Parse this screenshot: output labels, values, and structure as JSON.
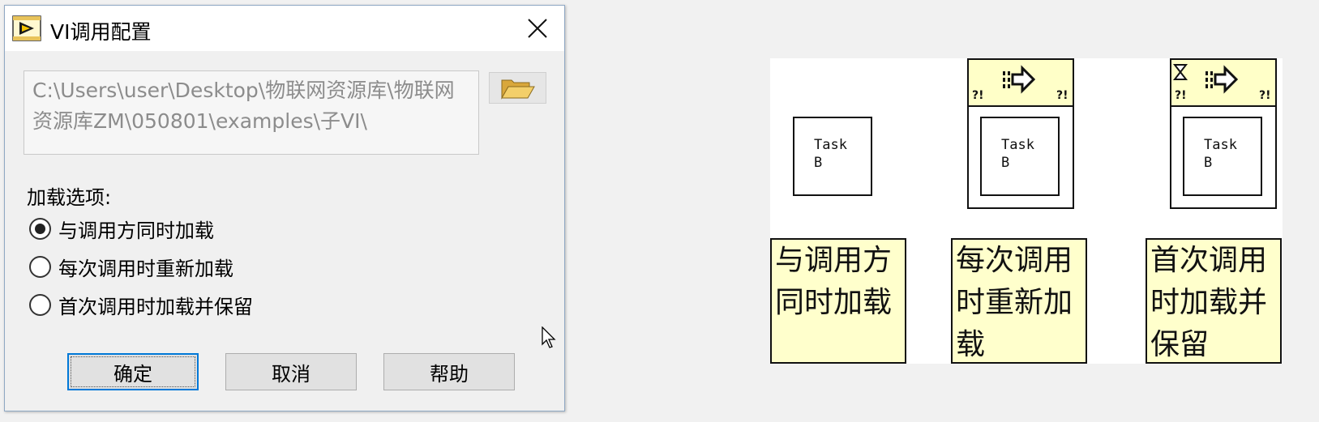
{
  "dialog": {
    "title": "VI调用配置",
    "path_value": "C:\\Users\\user\\Desktop\\物联网资源库\\物联网资源库ZM\\050801\\examples\\子VI\\",
    "load_options_label": "加载选项:",
    "options": [
      {
        "label": "与调用方同时加载",
        "checked": true
      },
      {
        "label": "每次调用时重新加载",
        "checked": false
      },
      {
        "label": "首次调用时加载并保留",
        "checked": false
      }
    ],
    "buttons": {
      "ok": "确定",
      "cancel": "取消",
      "help": "帮助"
    }
  },
  "illustration": {
    "subvi_label": "Task\nB",
    "captions": [
      "与调用方同时加载",
      "每次调用时重新加载",
      "首次调用时加载并保留"
    ],
    "colors": {
      "caption_bg": "#ffffcc",
      "node_header_bg": "#ffffc8",
      "accent": "#0078d7"
    },
    "icons": [
      "labview-vi-icon",
      "close-icon",
      "folder-open-icon",
      "arrow-cursor-icon",
      "run-arrow-icon",
      "hourglass-icon"
    ]
  }
}
